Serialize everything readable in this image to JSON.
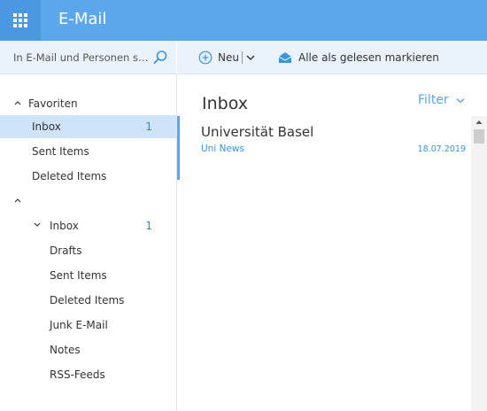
{
  "header": {
    "app_title": "E-Mail",
    "launcher_icon": "app-launcher-icon",
    "accent_color": "#5ca7ec"
  },
  "search": {
    "placeholder": "In E-Mail und Personen s…",
    "icon": "search-icon"
  },
  "toolbar": {
    "new_label": "Neu",
    "new_icon": "plus-circle-icon",
    "mark_read_label": "Alle als gelesen markieren",
    "mark_read_icon": "open-envelope-icon"
  },
  "nav": {
    "favorites_label": "Favoriten",
    "favorites": [
      {
        "label": "Inbox",
        "count": "1",
        "selected": true
      },
      {
        "label": "Sent Items",
        "count": ""
      },
      {
        "label": "Deleted Items",
        "count": ""
      }
    ],
    "account": {
      "inbox": {
        "label": "Inbox",
        "count": "1"
      },
      "folders": [
        {
          "label": "Drafts"
        },
        {
          "label": "Sent Items"
        },
        {
          "label": "Deleted Items"
        },
        {
          "label": "Junk E-Mail"
        },
        {
          "label": "Notes"
        },
        {
          "label": "RSS-Feeds"
        }
      ]
    }
  },
  "list": {
    "title": "Inbox",
    "filter_label": "Filter",
    "messages": [
      {
        "sender": "Universität Basel",
        "subject": "Uni News",
        "date": "18.07.2019"
      }
    ]
  }
}
